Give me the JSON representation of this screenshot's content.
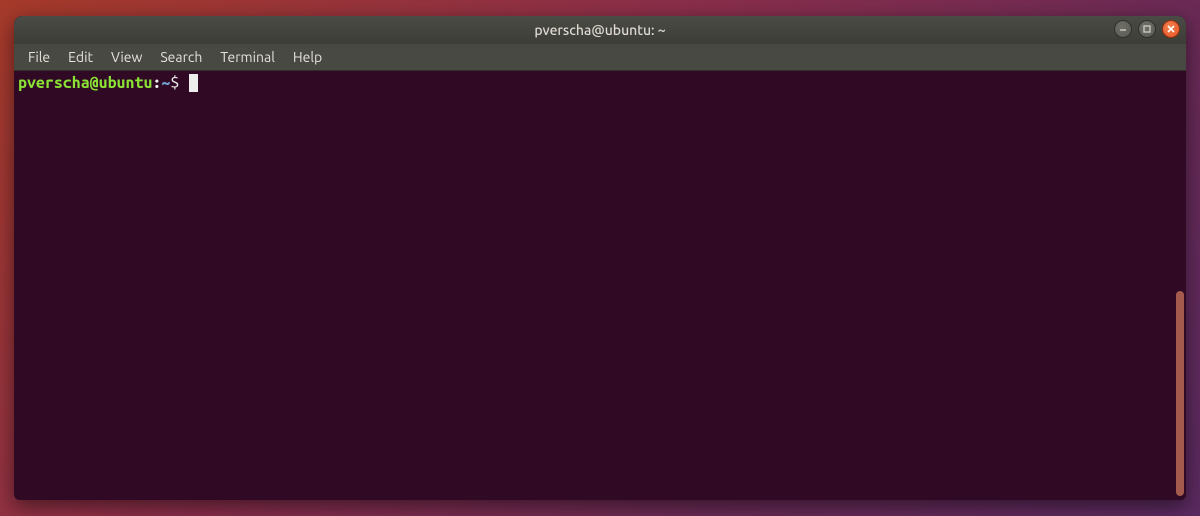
{
  "window": {
    "title": "pverscha@ubuntu: ~"
  },
  "menubar": {
    "items": [
      "File",
      "Edit",
      "View",
      "Search",
      "Terminal",
      "Help"
    ]
  },
  "prompt": {
    "user_host": "pverscha@ubuntu",
    "colon": ":",
    "path": "~",
    "symbol": "$"
  },
  "colors": {
    "terminal_bg": "#300a24",
    "prompt_user": "#8ae234",
    "prompt_path": "#729fcf",
    "text": "#eeeeec",
    "close_btn": "#e95420"
  }
}
